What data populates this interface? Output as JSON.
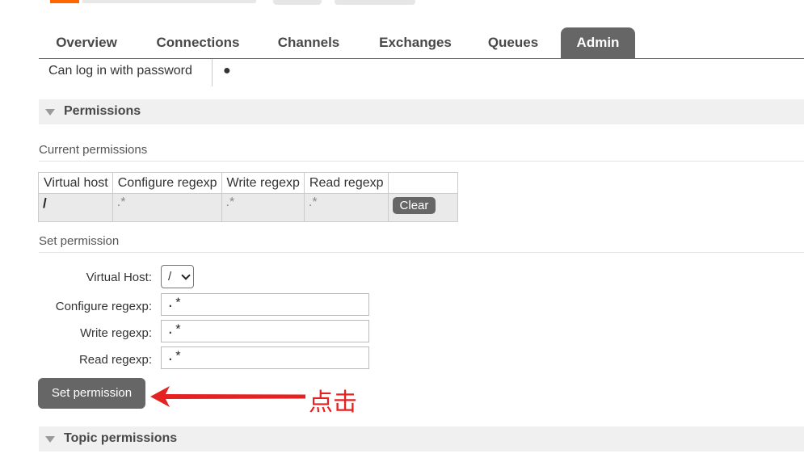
{
  "nav": {
    "tabs": [
      {
        "label": "Overview",
        "active": false
      },
      {
        "label": "Connections",
        "active": false
      },
      {
        "label": "Channels",
        "active": false
      },
      {
        "label": "Exchanges",
        "active": false
      },
      {
        "label": "Queues",
        "active": false
      },
      {
        "label": "Admin",
        "active": true
      }
    ]
  },
  "user": {
    "login_label": "Can log in with password",
    "login_value": "●"
  },
  "permissions": {
    "section_title": "Permissions",
    "current_title": "Current permissions",
    "table": {
      "headers": [
        "Virtual host",
        "Configure regexp",
        "Write regexp",
        "Read regexp"
      ],
      "rows": [
        {
          "vhost": "/",
          "configure": ".*",
          "write": ".*",
          "read": ".*",
          "action_label": "Clear"
        }
      ]
    },
    "set_title": "Set permission",
    "form": {
      "vhost_label": "Virtual Host:",
      "vhost_value": "/",
      "configure_label": "Configure regexp:",
      "configure_value": ".*",
      "write_label": "Write regexp:",
      "write_value": ".*",
      "read_label": "Read regexp:",
      "read_value": ".*",
      "submit_label": "Set permission"
    }
  },
  "annotation": {
    "text": "点击",
    "color": "#e52222"
  },
  "topic_permissions": {
    "section_title": "Topic permissions"
  },
  "colors": {
    "accent": "#666666",
    "section_bg": "#f0f0f0",
    "brand": "#ff6600"
  },
  "icons": {
    "section_toggle": "triangle-down-icon",
    "select_arrow": "chevron-down-icon",
    "annotation_arrow": "arrow-left-icon"
  }
}
